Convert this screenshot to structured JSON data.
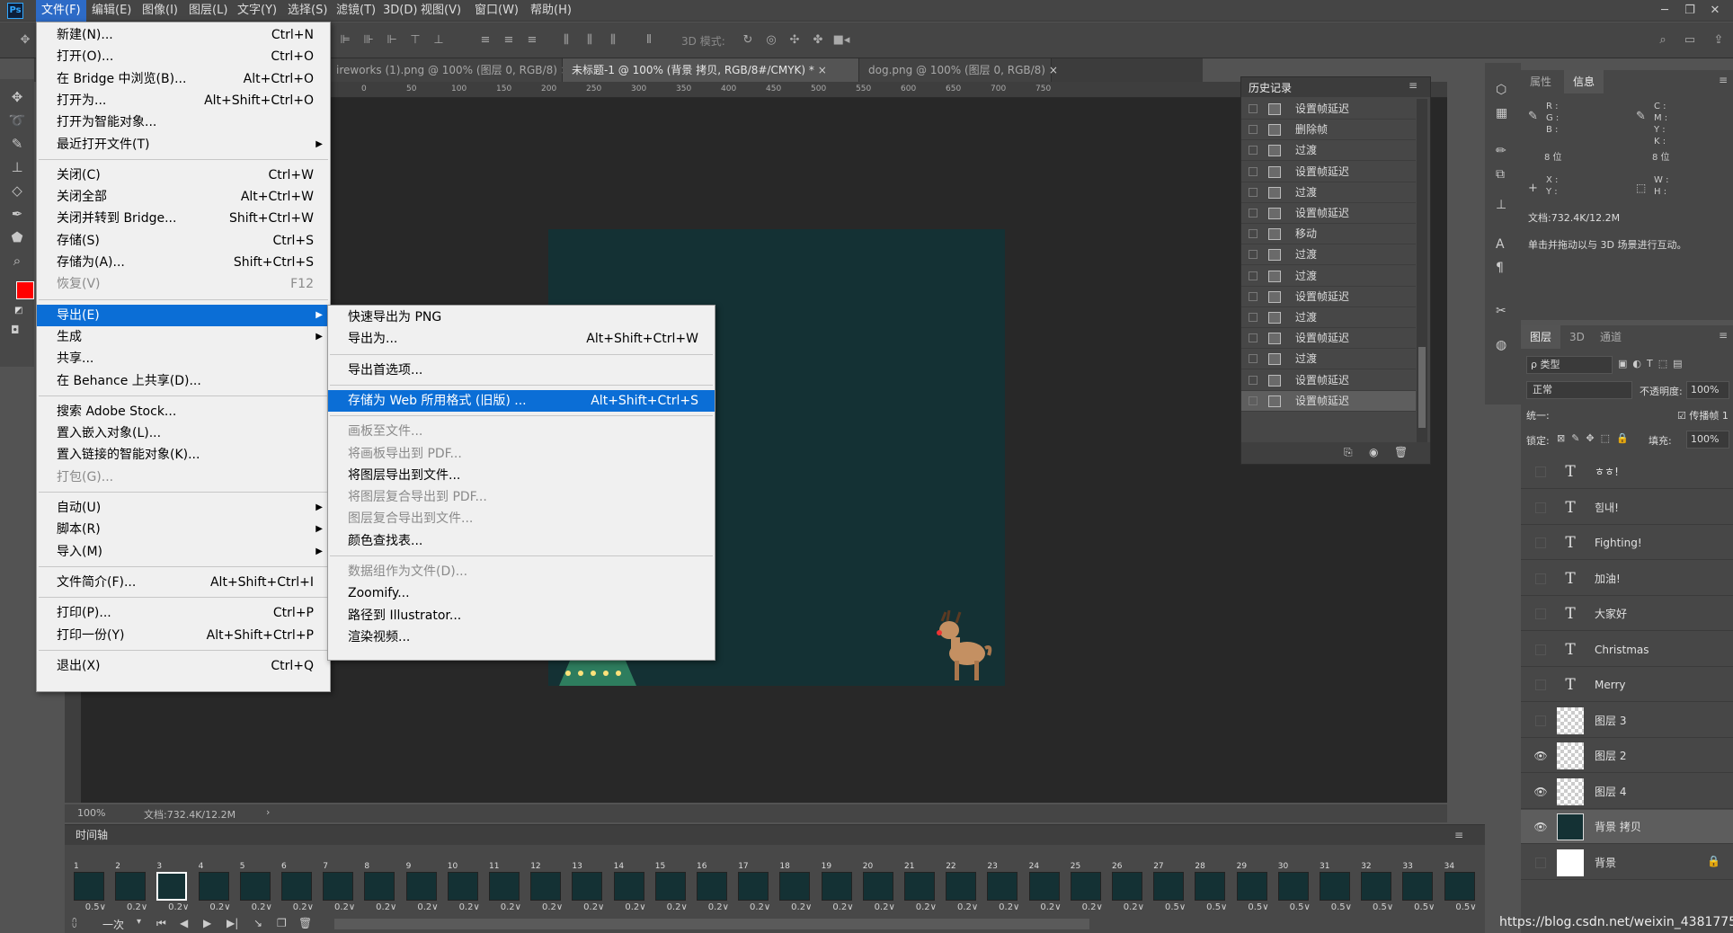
{
  "app": {
    "logo": "Ps"
  },
  "menubar": [
    {
      "label": "文件(F)",
      "active": true
    },
    {
      "label": "编辑(E)"
    },
    {
      "label": "图像(I)"
    },
    {
      "label": "图层(L)"
    },
    {
      "label": "文字(Y)"
    },
    {
      "label": "选择(S)"
    },
    {
      "label": "滤镜(T)"
    },
    {
      "label": "3D(D)"
    },
    {
      "label": "视图(V)"
    },
    {
      "label": "窗口(W)"
    },
    {
      "label": "帮助(H)"
    }
  ],
  "options_bar": {
    "mode_label": "3D 模式:"
  },
  "tabs": [
    {
      "label": "ireworks (1).png @ 100% (图层 0, RGB/8)"
    },
    {
      "label": "未标题-1 @ 100% (背景 拷贝, RGB/8#/CMYK) *",
      "active": true
    },
    {
      "label": "dog.png @ 100% (图层 0, RGB/8)"
    }
  ],
  "ruler_marks": [
    "50",
    "0",
    "50",
    "100",
    "150",
    "200",
    "250",
    "300",
    "350",
    "400",
    "450",
    "500",
    "550",
    "600",
    "650",
    "700",
    "750"
  ],
  "file_menu": {
    "groups": [
      [
        {
          "label": "新建(N)...",
          "shortcut": "Ctrl+N"
        },
        {
          "label": "打开(O)...",
          "shortcut": "Ctrl+O"
        },
        {
          "label": "在 Bridge 中浏览(B)...",
          "shortcut": "Alt+Ctrl+O"
        },
        {
          "label": "打开为...",
          "shortcut": "Alt+Shift+Ctrl+O"
        },
        {
          "label": "打开为智能对象..."
        },
        {
          "label": "最近打开文件(T)",
          "submenu": true
        }
      ],
      [
        {
          "label": "关闭(C)",
          "shortcut": "Ctrl+W"
        },
        {
          "label": "关闭全部",
          "shortcut": "Alt+Ctrl+W"
        },
        {
          "label": "关闭并转到 Bridge...",
          "shortcut": "Shift+Ctrl+W"
        },
        {
          "label": "存储(S)",
          "shortcut": "Ctrl+S"
        },
        {
          "label": "存储为(A)...",
          "shortcut": "Shift+Ctrl+S"
        },
        {
          "label": "恢复(V)",
          "shortcut": "F12",
          "disabled": true
        }
      ],
      [
        {
          "label": "导出(E)",
          "submenu": true,
          "highlighted": true
        },
        {
          "label": "生成",
          "submenu": true
        },
        {
          "label": "共享..."
        },
        {
          "label": "在 Behance 上共享(D)..."
        }
      ],
      [
        {
          "label": "搜索 Adobe Stock..."
        },
        {
          "label": "置入嵌入对象(L)..."
        },
        {
          "label": "置入链接的智能对象(K)..."
        },
        {
          "label": "打包(G)...",
          "disabled": true
        }
      ],
      [
        {
          "label": "自动(U)",
          "submenu": true
        },
        {
          "label": "脚本(R)",
          "submenu": true
        },
        {
          "label": "导入(M)",
          "submenu": true
        }
      ],
      [
        {
          "label": "文件简介(F)...",
          "shortcut": "Alt+Shift+Ctrl+I"
        }
      ],
      [
        {
          "label": "打印(P)...",
          "shortcut": "Ctrl+P"
        },
        {
          "label": "打印一份(Y)",
          "shortcut": "Alt+Shift+Ctrl+P"
        }
      ],
      [
        {
          "label": "退出(X)",
          "shortcut": "Ctrl+Q"
        }
      ]
    ]
  },
  "export_menu": {
    "groups": [
      [
        {
          "label": "快速导出为 PNG"
        },
        {
          "label": "导出为...",
          "shortcut": "Alt+Shift+Ctrl+W"
        }
      ],
      [
        {
          "label": "导出首选项..."
        }
      ],
      [
        {
          "label": "存储为 Web 所用格式 (旧版) ...",
          "shortcut": "Alt+Shift+Ctrl+S",
          "highlighted": true
        }
      ],
      [
        {
          "label": "画板至文件...",
          "disabled": true
        },
        {
          "label": "将画板导出到 PDF...",
          "disabled": true
        },
        {
          "label": "将图层导出到文件..."
        },
        {
          "label": "将图层复合导出到 PDF...",
          "disabled": true
        },
        {
          "label": "图层复合导出到文件...",
          "disabled": true
        },
        {
          "label": "颜色查找表..."
        }
      ],
      [
        {
          "label": "数据组作为文件(D)...",
          "disabled": true
        },
        {
          "label": "Zoomify..."
        },
        {
          "label": "路径到 Illustrator..."
        },
        {
          "label": "渲染视频..."
        }
      ]
    ]
  },
  "history_panel": {
    "title": "历史记录",
    "items": [
      {
        "label": "设置帧延迟"
      },
      {
        "label": "删除帧"
      },
      {
        "label": "过渡"
      },
      {
        "label": "设置帧延迟"
      },
      {
        "label": "过渡"
      },
      {
        "label": "设置帧延迟"
      },
      {
        "label": "移动"
      },
      {
        "label": "过渡"
      },
      {
        "label": "过渡"
      },
      {
        "label": "设置帧延迟"
      },
      {
        "label": "过渡"
      },
      {
        "label": "设置帧延迟"
      },
      {
        "label": "过渡"
      },
      {
        "label": "设置帧延迟"
      },
      {
        "label": "设置帧延迟",
        "selected": true
      }
    ]
  },
  "info_panel": {
    "tabs": [
      "属性",
      "信息"
    ],
    "active_tab": "信息",
    "rgb": "R :\nG :\nB :",
    "bits_left": "8 位",
    "cmyk": "C :\nM :\nY :\nK :",
    "bits_right": "8 位",
    "xy": "X :\nY :",
    "wh": "W :\nH :",
    "doc": "文档:732.4K/12.2M",
    "hint": "单击并拖动以与 3D 场景进行互动。"
  },
  "layers_panel": {
    "tabs": [
      "图层",
      "3D",
      "通道"
    ],
    "filter_label": "ρ 类型",
    "blend_mode": "正常",
    "opacity_label": "不透明度:",
    "opacity_value": "100%",
    "unify_label": "统一:",
    "propagate_label": "传播帧 1",
    "lock_label": "锁定:",
    "fill_label": "填充:",
    "fill_value": "100%",
    "layers": [
      {
        "name": "ㅎㅎ!",
        "type": "text",
        "visible": false
      },
      {
        "name": "힘내!",
        "type": "text",
        "visible": false
      },
      {
        "name": "Fighting!",
        "type": "text",
        "visible": false
      },
      {
        "name": "加油!",
        "type": "text",
        "visible": false
      },
      {
        "name": "大家好",
        "type": "text",
        "visible": false
      },
      {
        "name": "Christmas",
        "type": "text",
        "visible": false
      },
      {
        "name": "Merry",
        "type": "text",
        "visible": false
      },
      {
        "name": "图层 3",
        "type": "pixel",
        "visible": false
      },
      {
        "name": "图层 2",
        "type": "pixel",
        "visible": true
      },
      {
        "name": "图层 4",
        "type": "pixel",
        "visible": true
      },
      {
        "name": "背景 拷贝",
        "type": "fill",
        "visible": true,
        "selected": true
      },
      {
        "name": "背景",
        "type": "white",
        "visible": false,
        "locked": true
      }
    ]
  },
  "statusbar": {
    "zoom": "100%",
    "doc": "文档:732.4K/12.2M"
  },
  "timeline": {
    "title": "时间轴",
    "loop_label": "一次",
    "frames": [
      {
        "n": "1",
        "d": "0.5"
      },
      {
        "n": "2",
        "d": "0.2"
      },
      {
        "n": "3",
        "d": "0.2",
        "selected": true
      },
      {
        "n": "4",
        "d": "0.2"
      },
      {
        "n": "5",
        "d": "0.2"
      },
      {
        "n": "6",
        "d": "0.2"
      },
      {
        "n": "7",
        "d": "0.2"
      },
      {
        "n": "8",
        "d": "0.2"
      },
      {
        "n": "9",
        "d": "0.2"
      },
      {
        "n": "10",
        "d": "0.2"
      },
      {
        "n": "11",
        "d": "0.2"
      },
      {
        "n": "12",
        "d": "0.2"
      },
      {
        "n": "13",
        "d": "0.2"
      },
      {
        "n": "14",
        "d": "0.2"
      },
      {
        "n": "15",
        "d": "0.2"
      },
      {
        "n": "16",
        "d": "0.2"
      },
      {
        "n": "17",
        "d": "0.2"
      },
      {
        "n": "18",
        "d": "0.2"
      },
      {
        "n": "19",
        "d": "0.2"
      },
      {
        "n": "20",
        "d": "0.2"
      },
      {
        "n": "21",
        "d": "0.2"
      },
      {
        "n": "22",
        "d": "0.2"
      },
      {
        "n": "23",
        "d": "0.2"
      },
      {
        "n": "24",
        "d": "0.2"
      },
      {
        "n": "25",
        "d": "0.2"
      },
      {
        "n": "26",
        "d": "0.2"
      },
      {
        "n": "27",
        "d": "0.5"
      },
      {
        "n": "28",
        "d": "0.5"
      },
      {
        "n": "29",
        "d": "0.5"
      },
      {
        "n": "30",
        "d": "0.5"
      },
      {
        "n": "31",
        "d": "0.5"
      },
      {
        "n": "32",
        "d": "0.5"
      },
      {
        "n": "33",
        "d": "0.5"
      },
      {
        "n": "34",
        "d": "0.5"
      }
    ]
  },
  "colors": {
    "foreground": "#ff0000",
    "canvas_bg": "#143134",
    "accent": "#0b6ed6"
  },
  "watermark": "https://blog.csdn.net/weixin_4381775"
}
